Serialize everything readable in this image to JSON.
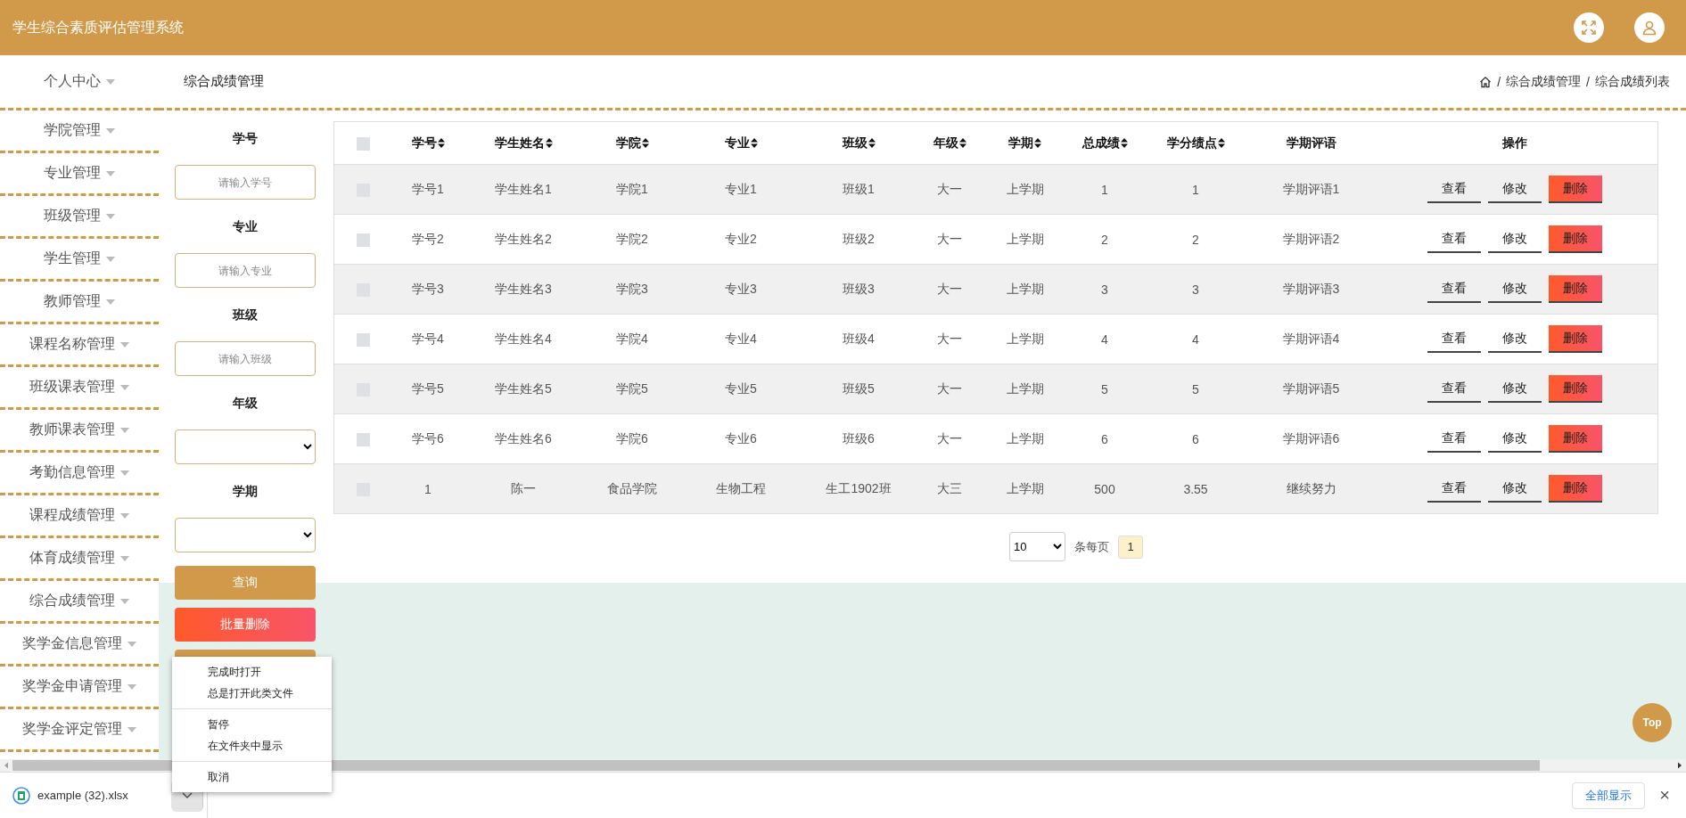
{
  "header": {
    "title": "学生综合素质评估管理系统"
  },
  "sidebar": {
    "items": [
      {
        "label": "个人中心"
      },
      {
        "label": "学院管理"
      },
      {
        "label": "专业管理"
      },
      {
        "label": "班级管理"
      },
      {
        "label": "学生管理"
      },
      {
        "label": "教师管理"
      },
      {
        "label": "课程名称管理"
      },
      {
        "label": "班级课表管理"
      },
      {
        "label": "教师课表管理"
      },
      {
        "label": "考勤信息管理"
      },
      {
        "label": "课程成绩管理"
      },
      {
        "label": "体育成绩管理"
      },
      {
        "label": "综合成绩管理"
      },
      {
        "label": "奖学金信息管理"
      },
      {
        "label": "奖学金申请管理"
      },
      {
        "label": "奖学金评定管理"
      }
    ]
  },
  "page_title": "综合成绩管理",
  "breadcrumb": {
    "separator": "/",
    "items": [
      "综合成绩管理",
      "综合成绩列表"
    ]
  },
  "search_form": {
    "fields": [
      {
        "kind": "input",
        "label": "学号",
        "placeholder": "请输入学号"
      },
      {
        "kind": "input",
        "label": "专业",
        "placeholder": "请输入专业"
      },
      {
        "kind": "input",
        "label": "班级",
        "placeholder": "请输入班级"
      },
      {
        "kind": "select",
        "label": "年级"
      },
      {
        "kind": "select",
        "label": "学期"
      }
    ],
    "buttons": [
      {
        "kind": "primary",
        "label": "查询"
      },
      {
        "kind": "danger",
        "label": "批量删除"
      },
      {
        "kind": "primary"
      }
    ]
  },
  "table": {
    "select_all": {
      "checked": false
    },
    "columns": [
      {
        "label": "学号",
        "sortable": true
      },
      {
        "label": "学生姓名",
        "sortable": true
      },
      {
        "label": "学院",
        "sortable": true
      },
      {
        "label": "专业",
        "sortable": true
      },
      {
        "label": "班级",
        "sortable": true
      },
      {
        "label": "年级",
        "sortable": true
      },
      {
        "label": "学期",
        "sortable": true
      },
      {
        "label": "总成绩",
        "sortable": true
      },
      {
        "label": "学分绩点",
        "sortable": true
      },
      {
        "label": "学期评语",
        "sortable": false
      },
      {
        "label": "操作",
        "sortable": false
      }
    ],
    "rows": [
      {
        "checked": false,
        "cells": [
          "学号1",
          "学生姓名1",
          "学院1",
          "专业1",
          "班级1",
          "大一",
          "上学期",
          "1",
          "1",
          "学期评语1"
        ],
        "actions": [
          {
            "kind": "view",
            "label": "查看"
          },
          {
            "kind": "edit",
            "label": "修改"
          },
          {
            "kind": "delete",
            "label": "删除"
          }
        ]
      },
      {
        "checked": false,
        "cells": [
          "学号2",
          "学生姓名2",
          "学院2",
          "专业2",
          "班级2",
          "大一",
          "上学期",
          "2",
          "2",
          "学期评语2"
        ],
        "actions": [
          {
            "kind": "view",
            "label": "查看"
          },
          {
            "kind": "edit",
            "label": "修改"
          },
          {
            "kind": "delete",
            "label": "删除"
          }
        ]
      },
      {
        "checked": false,
        "cells": [
          "学号3",
          "学生姓名3",
          "学院3",
          "专业3",
          "班级3",
          "大一",
          "上学期",
          "3",
          "3",
          "学期评语3"
        ],
        "actions": [
          {
            "kind": "view",
            "label": "查看"
          },
          {
            "kind": "edit",
            "label": "修改"
          },
          {
            "kind": "delete",
            "label": "删除"
          }
        ]
      },
      {
        "checked": false,
        "cells": [
          "学号4",
          "学生姓名4",
          "学院4",
          "专业4",
          "班级4",
          "大一",
          "上学期",
          "4",
          "4",
          "学期评语4"
        ],
        "actions": [
          {
            "kind": "view",
            "label": "查看"
          },
          {
            "kind": "edit",
            "label": "修改"
          },
          {
            "kind": "delete",
            "label": "删除"
          }
        ]
      },
      {
        "checked": false,
        "cells": [
          "学号5",
          "学生姓名5",
          "学院5",
          "专业5",
          "班级5",
          "大一",
          "上学期",
          "5",
          "5",
          "学期评语5"
        ],
        "actions": [
          {
            "kind": "view",
            "label": "查看"
          },
          {
            "kind": "edit",
            "label": "修改"
          },
          {
            "kind": "delete",
            "label": "删除"
          }
        ]
      },
      {
        "checked": false,
        "cells": [
          "学号6",
          "学生姓名6",
          "学院6",
          "专业6",
          "班级6",
          "大一",
          "上学期",
          "6",
          "6",
          "学期评语6"
        ],
        "actions": [
          {
            "kind": "view",
            "label": "查看"
          },
          {
            "kind": "edit",
            "label": "修改"
          },
          {
            "kind": "delete",
            "label": "删除"
          }
        ]
      },
      {
        "checked": false,
        "cells": [
          "1",
          "陈一",
          "食品学院",
          "生物工程",
          "生工1902班",
          "大三",
          "上学期",
          "500",
          "3.55",
          "继续努力"
        ],
        "actions": [
          {
            "kind": "view",
            "label": "查看"
          },
          {
            "kind": "edit",
            "label": "修改"
          },
          {
            "kind": "delete",
            "label": "删除"
          }
        ]
      }
    ]
  },
  "pagination": {
    "page_size": "10",
    "page_size_label": "条每页",
    "pages": [
      {
        "label": "1",
        "selected": true
      }
    ]
  },
  "back_to_top": {
    "label": "Top"
  },
  "download_menu": {
    "groups": [
      [
        "完成时打开",
        "总是打开此类文件"
      ],
      [
        "暂停",
        "在文件夹中显示"
      ],
      [
        "取消"
      ]
    ]
  },
  "download_bar": {
    "file_name": "example (32).xlsx",
    "show_all": "全部显示",
    "close": "×"
  }
}
